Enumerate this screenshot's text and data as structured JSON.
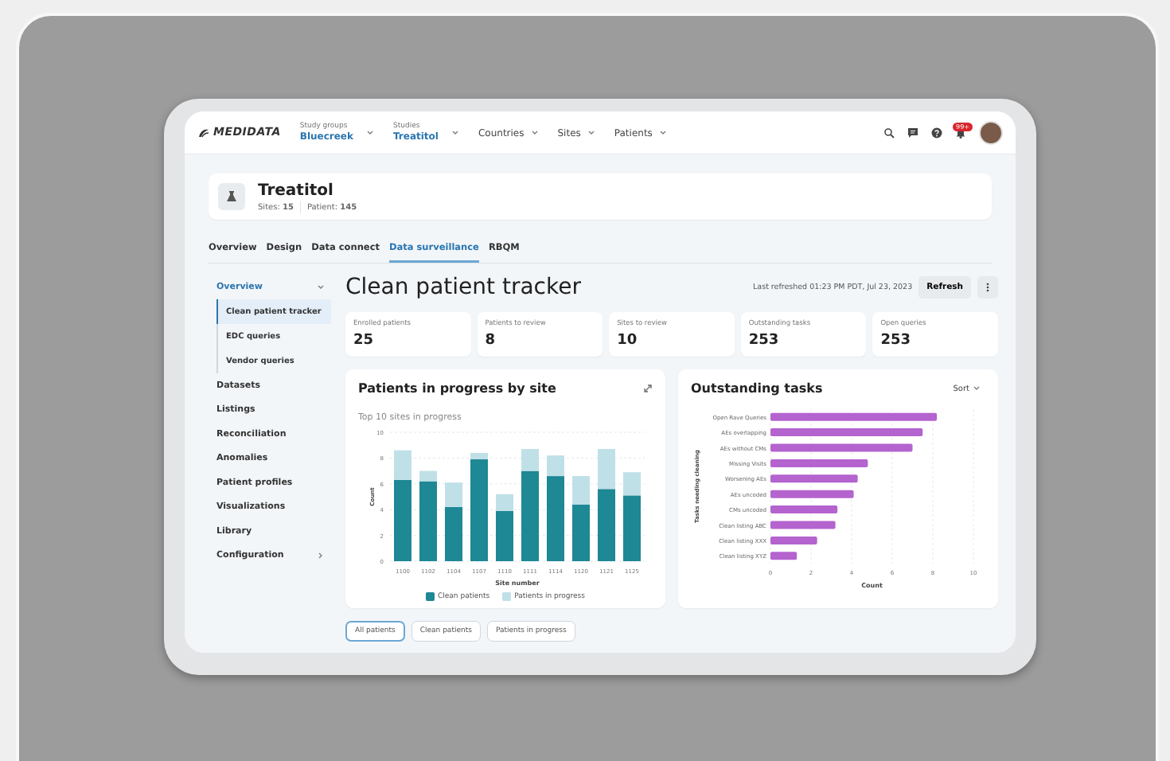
{
  "topbar": {
    "logo": "MEDIDATA",
    "selectors": [
      {
        "label": "Study groups",
        "value": "Bluecreek"
      },
      {
        "label": "Studies",
        "value": "Treatitol"
      }
    ],
    "menus": [
      "Countries",
      "Sites",
      "Patients"
    ],
    "notification_badge": "99+"
  },
  "study": {
    "name": "Treatitol",
    "sites": "Sites: **15**",
    "patients": "Patient: **145**"
  },
  "tabs": [
    {
      "label": "Overview",
      "selected": false
    },
    {
      "label": "Design",
      "selected": false
    },
    {
      "label": "Data connect",
      "selected": false
    },
    {
      "label": "Data surveillance",
      "selected": true
    },
    {
      "label": "RBQM",
      "selected": false
    }
  ],
  "sidebar": {
    "items": [
      {
        "label": "Overview",
        "kind": "group",
        "expanded": true,
        "children": [
          {
            "label": "Clean patient tracker",
            "selected": true
          },
          {
            "label": "EDC queries",
            "selected": false
          },
          {
            "label": "Vendor queries",
            "selected": false
          }
        ]
      },
      {
        "label": "Datasets",
        "kind": "link"
      },
      {
        "label": "Listings",
        "kind": "link"
      },
      {
        "label": "Reconciliation",
        "kind": "link"
      },
      {
        "label": "Anomalies",
        "kind": "link"
      },
      {
        "label": "Patient profiles",
        "kind": "link"
      },
      {
        "label": "Visualizations",
        "kind": "link"
      },
      {
        "label": "Library",
        "kind": "link"
      },
      {
        "label": "Configuration",
        "kind": "group",
        "expanded": false
      }
    ]
  },
  "page": {
    "title": "Clean patient tracker",
    "last_refreshed": "Last refreshed 01:23 PM PDT, Jul 23, 2023",
    "refresh_button": "Refresh"
  },
  "stats": [
    {
      "label": "Enrolled patients",
      "value": "25"
    },
    {
      "label": "Patients to review",
      "value": "8"
    },
    {
      "label": "Sites to review",
      "value": "10"
    },
    {
      "label": "Outstanding tasks",
      "value": "253"
    },
    {
      "label": "Open queries",
      "value": "253"
    }
  ],
  "site_chart": {
    "title": "Patients in progress by site",
    "subtitle": "Top 10 sites in progress",
    "chart_data": {
      "type": "bar",
      "stacked": true,
      "grid": true,
      "xlabel": "Site number",
      "ylabel": "Count",
      "categories": [
        "1100",
        "1102",
        "1104",
        "1107",
        "1110",
        "1111",
        "1114",
        "1120",
        "1121",
        "1125"
      ],
      "ylim": [
        0,
        10
      ],
      "yticks": [
        0,
        2,
        4,
        6,
        8,
        10
      ],
      "series": [
        {
          "name": "Clean patients",
          "color": "#1e8894",
          "values": [
            6.3,
            6.2,
            4.2,
            7.9,
            3.9,
            7.0,
            6.6,
            4.4,
            5.6,
            5.1
          ]
        },
        {
          "name": "Patients in progress",
          "color": "#c0e0e8",
          "values": [
            2.3,
            0.8,
            1.9,
            0.5,
            1.3,
            1.7,
            1.6,
            2.2,
            3.1,
            1.8
          ]
        }
      ]
    }
  },
  "tasks_chart": {
    "title": "Outstanding tasks",
    "sort": "Sort",
    "chart_data": {
      "type": "bar",
      "orientation": "horizontal",
      "grid": true,
      "xlabel": "Count",
      "ylabel": "Tasks needing cleaning",
      "categories": [
        "Open Rave Queries",
        "AEs overlapping",
        "AEs without CMs",
        "Missing Visits",
        "Worsening AEs",
        "AEs uncoded",
        "CMs uncoded",
        "Clean listing ABC",
        "Clean listing XXX",
        "Clean listing XYZ"
      ],
      "xlim": [
        0,
        10
      ],
      "xticks": [
        0,
        2,
        4,
        6,
        8,
        10
      ],
      "series": [
        {
          "color": "#b463cf",
          "values": [
            8.2,
            7.5,
            7.0,
            4.8,
            4.3,
            4.1,
            3.3,
            3.2,
            2.3,
            1.3
          ]
        }
      ]
    }
  },
  "filters": [
    {
      "label": "All patients",
      "selected": true
    },
    {
      "label": "Clean patients",
      "selected": false
    },
    {
      "label": "Patients in progress",
      "selected": false
    }
  ]
}
